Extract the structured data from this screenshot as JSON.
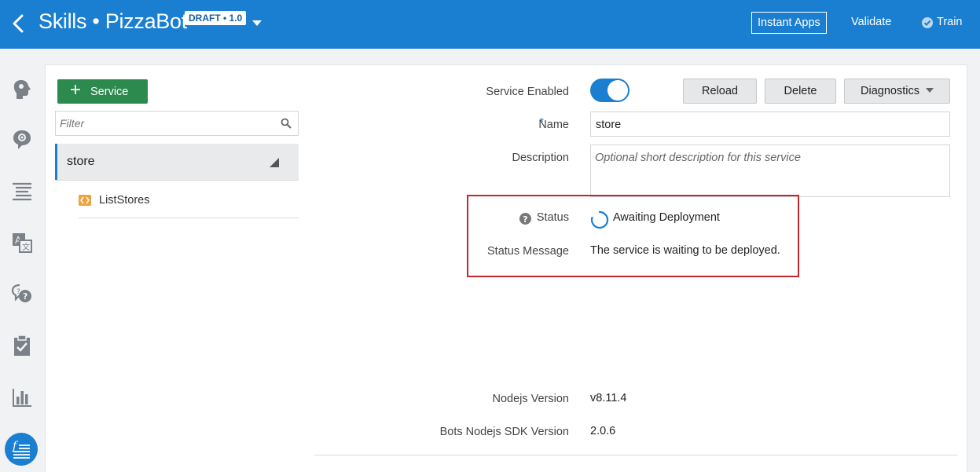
{
  "header": {
    "title": "Skills • PizzaBot",
    "badge": "DRAFT • 1.0",
    "instant_apps": "Instant Apps",
    "validate": "Validate",
    "train": "Train",
    "background": "#1a7fd1"
  },
  "leftnav": {
    "items": [
      {
        "icon": "intents-icon"
      },
      {
        "icon": "entities-icon"
      },
      {
        "icon": "flows-icon"
      },
      {
        "icon": "resource-bundles-icon"
      },
      {
        "icon": "qna-icon"
      },
      {
        "icon": "quality-icon"
      },
      {
        "icon": "insights-icon"
      },
      {
        "icon": "components-icon",
        "active": true
      }
    ]
  },
  "sidebar": {
    "add_service": "Service",
    "filter_placeholder": "Filter",
    "services": [
      {
        "name": "store",
        "components": [
          "ListStores"
        ]
      }
    ]
  },
  "form": {
    "service_enabled_label": "Service Enabled",
    "service_enabled": true,
    "reload": "Reload",
    "delete": "Delete",
    "diagnostics": "Diagnostics",
    "required_mark": "*",
    "name_label": "Name",
    "name_value": "store",
    "description_label": "Description",
    "description_placeholder": "Optional short description for this service",
    "status_label": "Status",
    "status_value": "Awaiting Deployment",
    "status_message_label": "Status Message",
    "status_message_value": "The service is waiting to be deployed.",
    "nodejs_label": "Nodejs Version",
    "nodejs_value": "v8.11.4",
    "sdk_label": "Bots Nodejs SDK Version",
    "sdk_value": "2.0.6"
  },
  "colors": {
    "accent": "#1a7fd1",
    "add_button": "#2c8a4e",
    "highlight": "#c2272d",
    "component_icon": "#f0a23c"
  }
}
